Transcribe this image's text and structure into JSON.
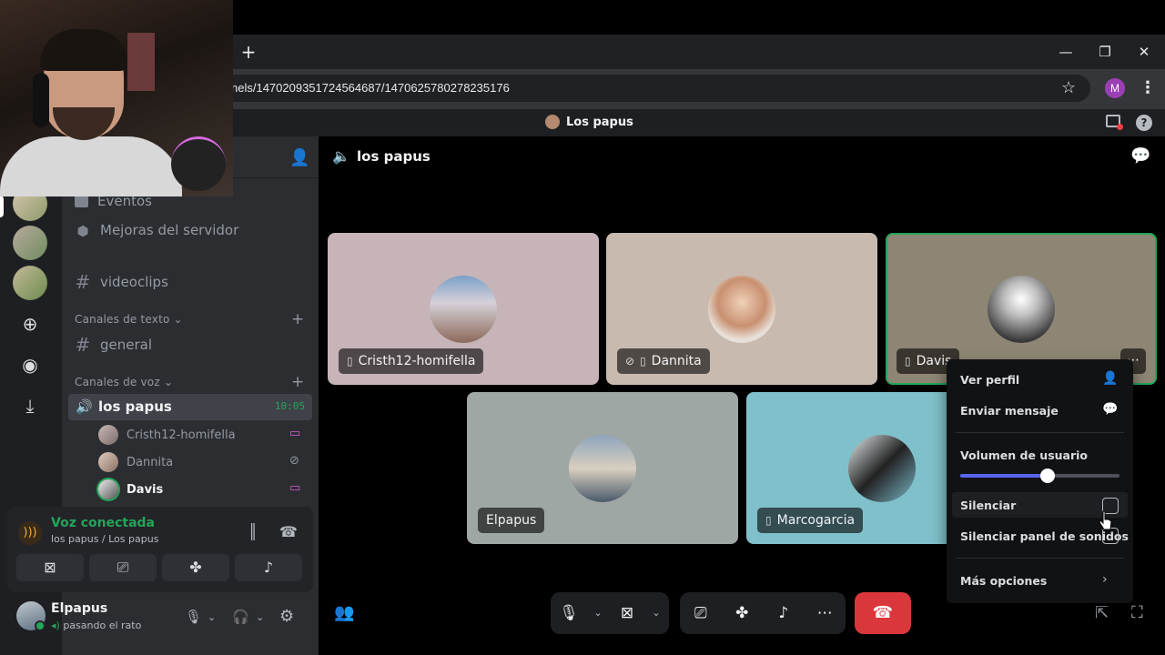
{
  "browser": {
    "url": "nels/1470209351724564687/1470625780278235176",
    "profile_initial": "M"
  },
  "app": {
    "title": "Los papus"
  },
  "sidebar": {
    "channels_top": [
      {
        "label": "Eventos"
      },
      {
        "label": "Mejoras del servidor"
      },
      {
        "label": "videoclips"
      }
    ],
    "text_category": "Canales de texto",
    "text_channels": [
      {
        "label": "general"
      }
    ],
    "voice_category": "Canales de voz",
    "voice_channel": {
      "label": "los papus",
      "timer": "10:05"
    },
    "voice_users": [
      {
        "name": "Cristh12-homifella",
        "status": "phone"
      },
      {
        "name": "Dannita",
        "status": "muted"
      },
      {
        "name": "Davis",
        "status": "phone"
      }
    ]
  },
  "voice_panel": {
    "status": "Voz conectada",
    "location": "los papus / Los papus"
  },
  "user_panel": {
    "name": "Elpapus",
    "status": "pasando el rato"
  },
  "main": {
    "channel_title": "los papus",
    "tiles": [
      {
        "name": "Cristh12-homifella",
        "bg": "#c6b4b8"
      },
      {
        "name": "Dannita",
        "bg": "#c9bab0"
      },
      {
        "name": "Davis",
        "bg": "#8e8674"
      },
      {
        "name": "Elpapus",
        "bg": "#9ea7a4"
      },
      {
        "name": "Marcogarcia",
        "bg": "#7fc0ca"
      }
    ]
  },
  "context_menu": {
    "view_profile": "Ver perfil",
    "send_message": "Enviar mensaje",
    "user_volume": "Volumen de usuario",
    "volume_level": 0.55,
    "mute": "Silenciar",
    "mute_soundboard": "Silenciar panel de sonidos",
    "more_options": "Más opciones"
  },
  "colors": {
    "accent": "#5865f2",
    "online": "#23a55a",
    "hangup": "#da373c"
  }
}
